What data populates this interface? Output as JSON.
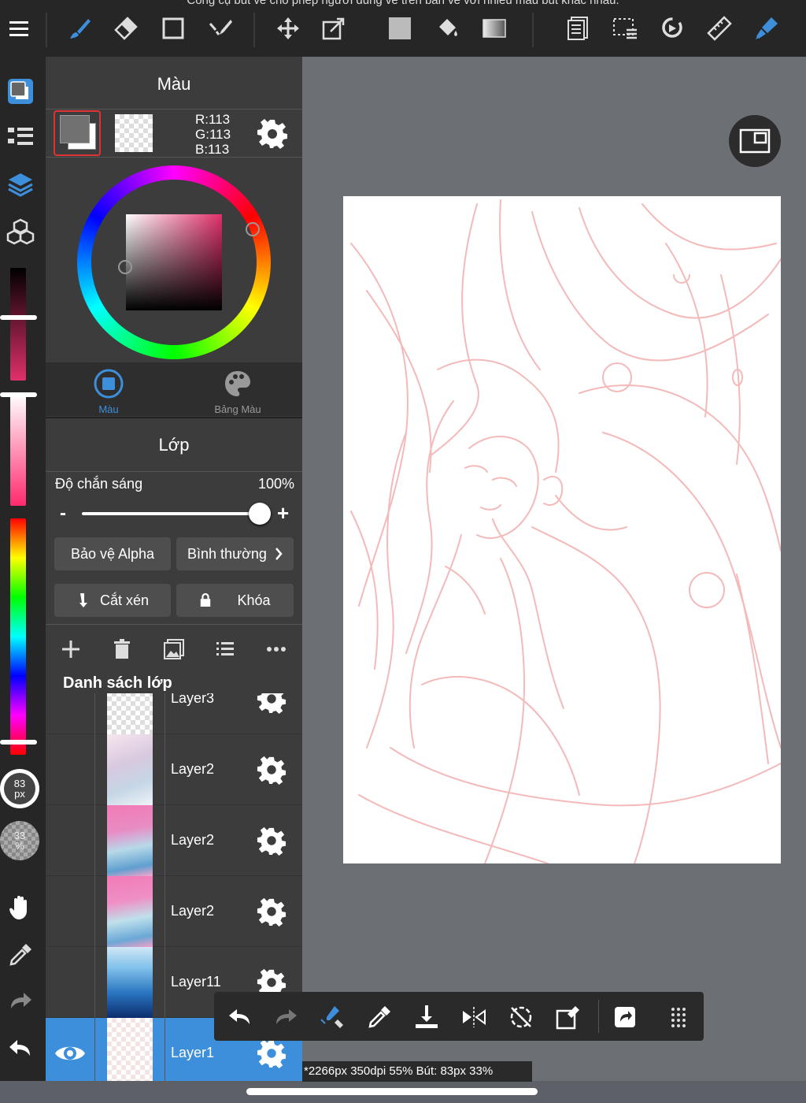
{
  "caption": "Công cụ bút vẽ cho phép người dùng vẽ trên bản vẽ với nhiều màu bút khác nhau.",
  "color_panel": {
    "title": "Màu",
    "rgb": {
      "r": "R:113",
      "g": "G:113",
      "b": "B:113"
    },
    "tab_color": "Màu",
    "tab_palette": "Bảng Màu"
  },
  "layer_panel": {
    "title": "Lớp",
    "opacity_label": "Độ chắn sáng",
    "opacity_value": "100%",
    "opacity_fraction": 1.0,
    "minus": "-",
    "plus": "+",
    "alpha_protect": "Bảo vệ Alpha",
    "blend_mode": "Bình thường",
    "clipping": "Cắt xén",
    "lock": "Khóa",
    "list_title": "Danh sách lớp",
    "layers": [
      {
        "name": "Layer3"
      },
      {
        "name": "Layer2"
      },
      {
        "name": "Layer2"
      },
      {
        "name": "Layer2"
      },
      {
        "name": "Layer11"
      },
      {
        "name": "Layer1"
      }
    ]
  },
  "left_strip": {
    "brush_size": "83",
    "brush_size_unit": "px",
    "brush_opacity": "33",
    "brush_opacity_unit": "%"
  },
  "status_bar": "*2266px 350dpi 55% Bút: 83px 33%",
  "colors": {
    "accent_blue": "#3d8fdb",
    "toolbar_bg": "#262626",
    "panel_bg": "#3c3c3c",
    "canvas_bg": "#ffffff",
    "sketch_stroke": "#f4b9b9",
    "selection_red": "#dd3333"
  },
  "icons": {
    "top": [
      "menu-icon",
      "brush-icon",
      "eraser-icon",
      "rectangle-icon",
      "selection-pen-icon",
      "move-icon",
      "transform-icon",
      "fill-color-icon",
      "bucket-icon",
      "gradient-icon",
      "layers-page-icon",
      "select-all-icon",
      "lasso-icon",
      "ruler-icon",
      "snap-icon"
    ],
    "bottom": [
      "undo-icon",
      "redo-icon",
      "brush-eraser-toggle-icon",
      "eyedropper-icon",
      "save-icon",
      "flip-icon",
      "rotate-reset-icon",
      "clear-icon",
      "share-icon",
      "grid-menu-icon"
    ]
  }
}
